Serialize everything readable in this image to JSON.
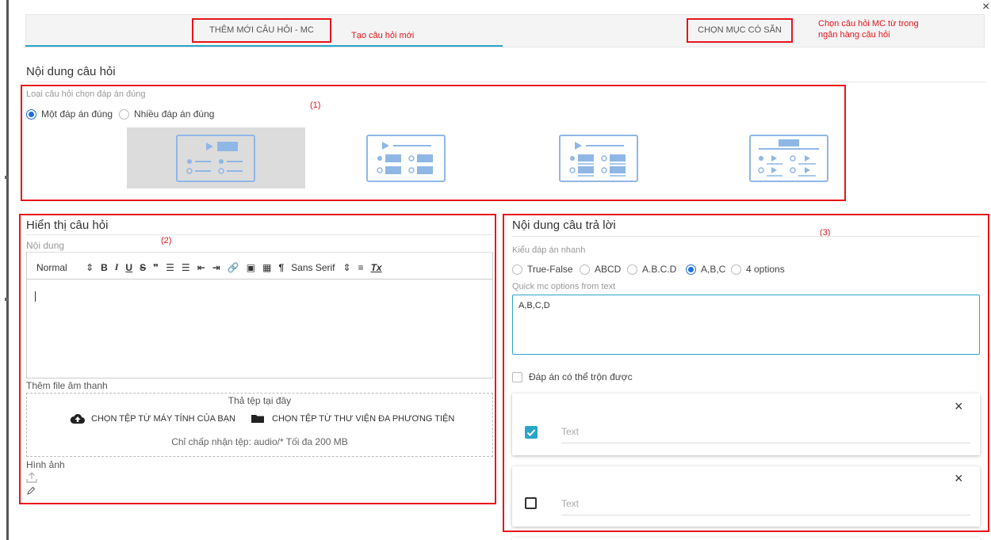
{
  "tabs": {
    "new_question": "THÊM MỚI CÂU HỎI - MC",
    "new_question_note": "Tạo câu hỏi mới",
    "choose_existing": "CHỌN MỤC CÓ SẴN",
    "choose_existing_note_1": "Chọn câu hỏi MC từ trong",
    "choose_existing_note_2": "ngân hàng câu hỏi"
  },
  "close_label": "×",
  "content_section": {
    "title": "Nội dung câu hỏi",
    "type_label": "Loại câu hỏi chọn đáp án đúng",
    "marker": "(1)",
    "options": [
      {
        "label": "Một đáp án đúng",
        "selected": true
      },
      {
        "label": "Nhiều đáp án đúng",
        "selected": false
      }
    ],
    "selected_layout": 1
  },
  "display_section": {
    "title": "Hiển thị câu hỏi",
    "marker": "(2)",
    "content_label": "Nội dung",
    "editor": {
      "format": "Normal",
      "font": "Sans Serif",
      "buttons": {
        "bold": "B",
        "italic": "I",
        "underline": "U",
        "strike": "S",
        "quote": "❞",
        "ol": "☰",
        "ul": "☰",
        "outdent": "⇤",
        "indent": "⇥",
        "link": "🔗",
        "image": "▣",
        "video": "▦",
        "formula": "¶",
        "clear": "Tx",
        "align": "≡"
      }
    },
    "audio_label": "Thêm file âm thanh",
    "drop_hint": "Thả tệp tại đây",
    "choose_computer": "CHỌN TỆP TỪ MÁY TÍNH CỦA BẠN",
    "choose_library": "CHỌN TỆP TỪ THƯ VIỆN ĐA PHƯƠNG TIỆN",
    "accept_note": "Chỉ chấp nhận tệp: audio/* Tối đa 200 MB",
    "image_label": "Hình ảnh"
  },
  "answer_section": {
    "title": "Nội dung câu trả lời",
    "marker": "(3)",
    "quick_type_label": "Kiểu đáp án nhanh",
    "quick_types": [
      {
        "label": "True-False",
        "selected": false
      },
      {
        "label": "ABCD",
        "selected": false
      },
      {
        "label": "A.B.C.D",
        "selected": false
      },
      {
        "label": "A,B,C",
        "selected": true
      },
      {
        "label": "4 options",
        "selected": false
      }
    ],
    "quick_text_label": "Quick mc options from text",
    "quick_text_value": "A,B,C,D",
    "shuffle_label": "Đáp án có thể trộn được",
    "answers": [
      {
        "placeholder": "Text",
        "checked": true
      },
      {
        "placeholder": "Text",
        "checked": false
      }
    ]
  },
  "colors": {
    "accent": "#2aa5c9",
    "annotation": "#e8141c",
    "radio": "#1f6fd8",
    "layout_icon": "#8fb7e6"
  }
}
